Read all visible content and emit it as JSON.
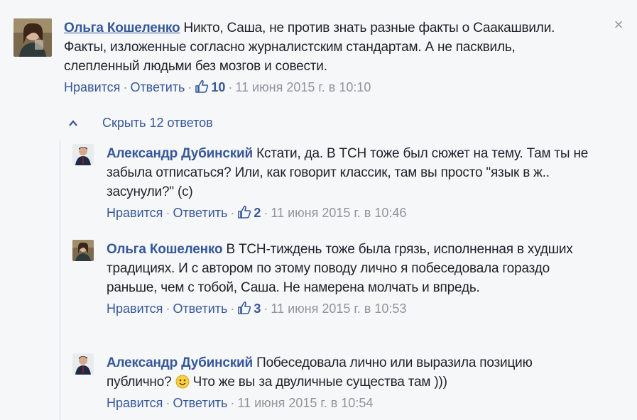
{
  "thread": {
    "hide_replies_label": "Скрыть 12 ответов"
  },
  "comments": [
    {
      "author": "Ольга Кошеленко",
      "text": " Никто, Саша, не против знать разные факты о Саакашвили. Факты, изложенные согласно журналистским стандартам. А не пасквиль, слепленный людьми без мозгов и совести.",
      "like_label": "Нравится",
      "reply_label": "Ответить",
      "like_count": "10",
      "timestamp": "11 июня 2015 г. в 10:10"
    },
    {
      "author": "Александр Дубинский",
      "text": " Кстати, да. В ТСН тоже был сюжет на тему. Там ты не забыла отписаться? Или, как говорит классик, там вы просто \"язык в ж.. засунули?\" (с)",
      "like_label": "Нравится",
      "reply_label": "Ответить",
      "like_count": "2",
      "timestamp": "11 июня 2015 г. в 10:46"
    },
    {
      "author": "Ольга Кошеленко",
      "text": " В ТСН-тиждень тоже была грязь, исполненная в худших традициях. И с автором по этому поводу лично я побеседовала гораздо раньше, чем с тобой, Саша. Не намерена молчать и впредь.",
      "like_label": "Нравится",
      "reply_label": "Ответить",
      "like_count": "3",
      "timestamp": "11 июня 2015 г. в 10:53"
    },
    {
      "author": "Александр Дубинский",
      "text_before_emoji": " Побеседовала лично или выразила позицию публично? ",
      "text_after_emoji": " Что же вы за двуличные существа там )))",
      "like_label": "Нравится",
      "reply_label": "Ответить",
      "timestamp": "11 июня 2015 г. в 10:54"
    }
  ],
  "icons": {
    "close": "close-icon",
    "like": "thumbs-up-icon",
    "chevron": "chevron-up-icon",
    "emoji": "smile-emoji-icon"
  },
  "colors": {
    "link": "#365899",
    "text": "#1d2129",
    "meta": "#90949c",
    "background": "#f6f7f9"
  }
}
